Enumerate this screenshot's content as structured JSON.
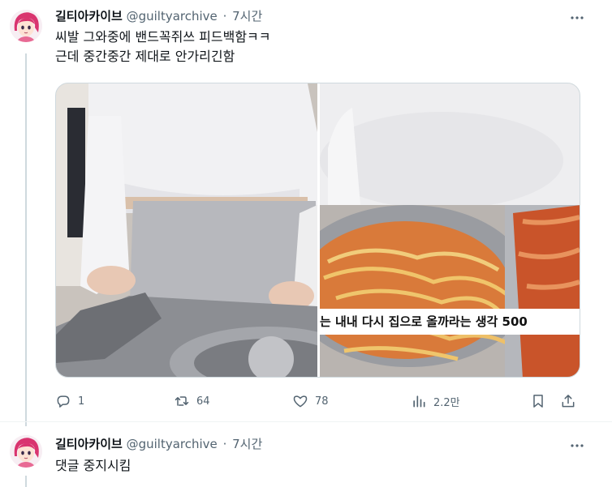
{
  "tweets": [
    {
      "author": {
        "name": "길티아카이브",
        "handle": "@guiltyarchive",
        "avatar_icon": "anime-girl-avatar"
      },
      "separator": "·",
      "time": "7시간",
      "text": "씨발 그와중에 밴드꼭쥐쓰 피드백함ㅋㅋ\n근데 중간중간 제대로 안가리긴함",
      "media": {
        "images": [
          {
            "description_icon": "photo-person-gas-stove"
          },
          {
            "description_icon": "photo-ramen-kimchi",
            "caption": "는 내내 다시 집으로 올까라는 생각 500"
          }
        ]
      },
      "actions": {
        "reply": {
          "icon": "reply-icon",
          "count": "1"
        },
        "retweet": {
          "icon": "retweet-icon",
          "count": "64"
        },
        "like": {
          "icon": "heart-icon",
          "count": "78"
        },
        "views": {
          "icon": "analytics-icon",
          "count": "2.2만"
        },
        "bookmark": {
          "icon": "bookmark-icon"
        },
        "share": {
          "icon": "share-icon"
        }
      }
    },
    {
      "author": {
        "name": "길티아카이브",
        "handle": "@guiltyarchive",
        "avatar_icon": "anime-girl-avatar"
      },
      "separator": "·",
      "time": "7시간",
      "text": "댓글 중지시킴"
    }
  ],
  "colors": {
    "text_primary": "#0f1419",
    "text_secondary": "#536471",
    "border": "#cfd9de",
    "avatar_hair": "#d9346f"
  }
}
